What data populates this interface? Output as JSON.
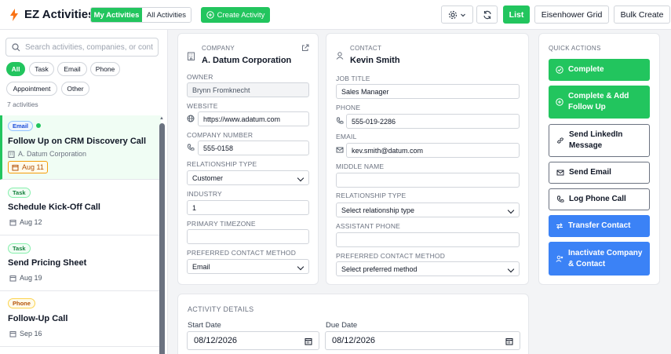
{
  "header": {
    "app_title": "EZ Activities",
    "my_activities": "My Activities",
    "all_activities": "All Activities",
    "create_activity": "Create Activity",
    "list": "List",
    "eisenhower": "Eisenhower Grid",
    "bulk_create": "Bulk Create"
  },
  "sidebar": {
    "search_placeholder": "Search activities, companies, or cont",
    "filters": [
      "All",
      "Task",
      "Email",
      "Phone",
      "Appointment",
      "Other"
    ],
    "count": "7 activities",
    "activities": [
      {
        "type": "Email",
        "title": "Follow Up on CRM Discovery Call",
        "company": "A. Datum Corporation",
        "date": "Aug 11"
      },
      {
        "type": "Task",
        "title": "Schedule Kick-Off Call",
        "date": "Aug 12"
      },
      {
        "type": "Task",
        "title": "Send Pricing Sheet",
        "date": "Aug 19"
      },
      {
        "type": "Phone",
        "title": "Follow-Up Call",
        "date": "Sep 16"
      }
    ]
  },
  "company": {
    "section": "COMPANY",
    "name": "A. Datum Corporation",
    "owner_label": "OWNER",
    "owner": "Brynn Fromknecht",
    "website_label": "WEBSITE",
    "website": "https://www.adatum.com",
    "number_label": "COMPANY NUMBER",
    "number": "555-0158",
    "rel_label": "RELATIONSHIP TYPE",
    "rel": "Customer",
    "industry_label": "INDUSTRY",
    "industry": "1",
    "tz_label": "PRIMARY TIMEZONE",
    "tz": "",
    "pcm_label": "PREFERRED CONTACT METHOD",
    "pcm": "Email"
  },
  "contact": {
    "section": "CONTACT",
    "name": "Kevin Smith",
    "job_label": "JOB TITLE",
    "job": "Sales Manager",
    "phone_label": "PHONE",
    "phone": "555-019-2286",
    "email_label": "EMAIL",
    "email": "kev.smith@datum.com",
    "middle_label": "MIDDLE NAME",
    "middle": "",
    "rel_label": "RELATIONSHIP TYPE",
    "rel": "Select relationship type",
    "asst_label": "ASSISTANT PHONE",
    "asst": "",
    "pcm_label": "PREFERRED CONTACT METHOD",
    "pcm": "Select preferred method"
  },
  "quick_actions": {
    "section": "QUICK ACTIONS",
    "complete": "Complete",
    "complete_follow_1": "Complete & Add",
    "complete_follow_2": "Follow Up",
    "linkedin_1": "Send LinkedIn",
    "linkedin_2": "Message",
    "email": "Send Email",
    "phone": "Log Phone Call",
    "transfer": "Transfer Contact",
    "inactivate_1": "Inactivate Company",
    "inactivate_2": "& Contact"
  },
  "activity_details": {
    "section": "ACTIVITY DETAILS",
    "start_label": "Start Date",
    "start": "08/12/2026",
    "due_label": "Due Date",
    "due": "08/12/2026"
  },
  "colors": {
    "accent": "#22c55e",
    "blue": "#3b82f6",
    "logo": "#f97316"
  }
}
